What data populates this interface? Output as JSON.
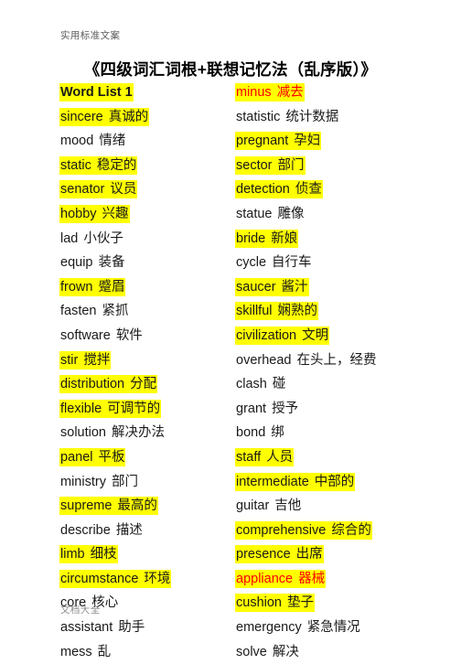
{
  "header": {
    "running_head": "实用标准文案"
  },
  "title": "《四级词汇词根+联想记忆法（乱序版）》",
  "footer": {
    "running_foot": "文档大全"
  },
  "colors": {
    "highlight": "#ffff00",
    "red_text": "#ff0000",
    "body_text": "#1a1a1a",
    "header_text": "#5a5a5a",
    "footer_text": "#8c8c8c"
  },
  "columns": {
    "left": [
      {
        "word": "Word List 1",
        "cn": "",
        "highlight": true,
        "red": false,
        "bold": true
      },
      {
        "word": "sincere",
        "cn": "真诚的",
        "highlight": true,
        "red": false,
        "bold": false
      },
      {
        "word": "mood",
        "cn": "情绪",
        "highlight": false,
        "red": false,
        "bold": false
      },
      {
        "word": "static",
        "cn": "稳定的",
        "highlight": true,
        "red": false,
        "bold": false
      },
      {
        "word": "senator",
        "cn": "议员",
        "highlight": true,
        "red": false,
        "bold": false
      },
      {
        "word": "hobby",
        "cn": "兴趣",
        "highlight": true,
        "red": false,
        "bold": false
      },
      {
        "word": "lad",
        "cn": "小伙子",
        "highlight": false,
        "red": false,
        "bold": false
      },
      {
        "word": "equip",
        "cn": "装备",
        "highlight": false,
        "red": false,
        "bold": false
      },
      {
        "word": "frown",
        "cn": "蹙眉",
        "highlight": true,
        "red": false,
        "bold": false
      },
      {
        "word": "fasten",
        "cn": "紧抓",
        "highlight": false,
        "red": false,
        "bold": false
      },
      {
        "word": "software",
        "cn": "软件",
        "highlight": false,
        "red": false,
        "bold": false
      },
      {
        "word": "stir",
        "cn": "搅拌",
        "highlight": true,
        "red": false,
        "bold": false
      },
      {
        "word": "distribution",
        "cn": "分配",
        "highlight": true,
        "red": false,
        "bold": false
      },
      {
        "word": "flexible",
        "cn": "可调节的",
        "highlight": true,
        "red": false,
        "bold": false
      },
      {
        "word": "solution",
        "cn": "解决办法",
        "highlight": false,
        "red": false,
        "bold": false
      },
      {
        "word": "panel",
        "cn": "平板",
        "highlight": true,
        "red": false,
        "bold": false
      },
      {
        "word": "ministry",
        "cn": "部门",
        "highlight": false,
        "red": false,
        "bold": false
      },
      {
        "word": "supreme",
        "cn": "最高的",
        "highlight": true,
        "red": false,
        "bold": false
      },
      {
        "word": "describe",
        "cn": "描述",
        "highlight": false,
        "red": false,
        "bold": false
      },
      {
        "word": "limb",
        "cn": "细枝",
        "highlight": true,
        "red": false,
        "bold": false
      },
      {
        "word": "circumstance",
        "cn": "环境",
        "highlight": true,
        "red": false,
        "bold": false
      },
      {
        "word": "core",
        "cn": "核心",
        "highlight": false,
        "red": false,
        "bold": false
      },
      {
        "word": "assistant",
        "cn": "助手",
        "highlight": false,
        "red": false,
        "bold": false
      },
      {
        "word": "mess",
        "cn": "乱",
        "highlight": false,
        "red": false,
        "bold": false
      }
    ],
    "right": [
      {
        "word": "minus",
        "cn": "减去",
        "highlight": true,
        "red": true,
        "bold": false
      },
      {
        "word": "statistic",
        "cn": "统计数据",
        "highlight": false,
        "red": false,
        "bold": false
      },
      {
        "word": "pregnant",
        "cn": "孕妇",
        "highlight": true,
        "red": false,
        "bold": false
      },
      {
        "word": "sector",
        "cn": "部门",
        "highlight": true,
        "red": false,
        "bold": false
      },
      {
        "word": "detection",
        "cn": "侦查",
        "highlight": true,
        "red": false,
        "bold": false
      },
      {
        "word": "statue",
        "cn": "雕像",
        "highlight": false,
        "red": false,
        "bold": false
      },
      {
        "word": "bride",
        "cn": "新娘",
        "highlight": true,
        "red": false,
        "bold": false
      },
      {
        "word": "cycle",
        "cn": "自行车",
        "highlight": false,
        "red": false,
        "bold": false
      },
      {
        "word": "saucer",
        "cn": "酱汁",
        "highlight": true,
        "red": false,
        "bold": false
      },
      {
        "word": "skillful",
        "cn": "娴熟的",
        "highlight": true,
        "red": false,
        "bold": false
      },
      {
        "word": "civilization",
        "cn": "文明",
        "highlight": true,
        "red": false,
        "bold": false
      },
      {
        "word": "overhead",
        "cn": "在头上，经费",
        "highlight": false,
        "red": false,
        "bold": false
      },
      {
        "word": "clash",
        "cn": "碰",
        "highlight": false,
        "red": false,
        "bold": false
      },
      {
        "word": "grant",
        "cn": "授予",
        "highlight": false,
        "red": false,
        "bold": false
      },
      {
        "word": "bond",
        "cn": "绑",
        "highlight": false,
        "red": false,
        "bold": false
      },
      {
        "word": "staff",
        "cn": "人员",
        "highlight": true,
        "red": false,
        "bold": false
      },
      {
        "word": "intermediate",
        "cn": "中部的",
        "highlight": true,
        "red": false,
        "bold": false
      },
      {
        "word": "guitar",
        "cn": "吉他",
        "highlight": false,
        "red": false,
        "bold": false
      },
      {
        "word": "comprehensive",
        "cn": "综合的",
        "highlight": true,
        "red": false,
        "bold": false
      },
      {
        "word": "presence",
        "cn": "出席",
        "highlight": true,
        "red": false,
        "bold": false
      },
      {
        "word": "appliance",
        "cn": "器械",
        "highlight": true,
        "red": true,
        "bold": false
      },
      {
        "word": "cushion",
        "cn": "垫子",
        "highlight": true,
        "red": false,
        "bold": false
      },
      {
        "word": "emergency",
        "cn": "紧急情况",
        "highlight": false,
        "red": false,
        "bold": false
      },
      {
        "word": "solve",
        "cn": "解决",
        "highlight": false,
        "red": false,
        "bold": false
      }
    ]
  }
}
